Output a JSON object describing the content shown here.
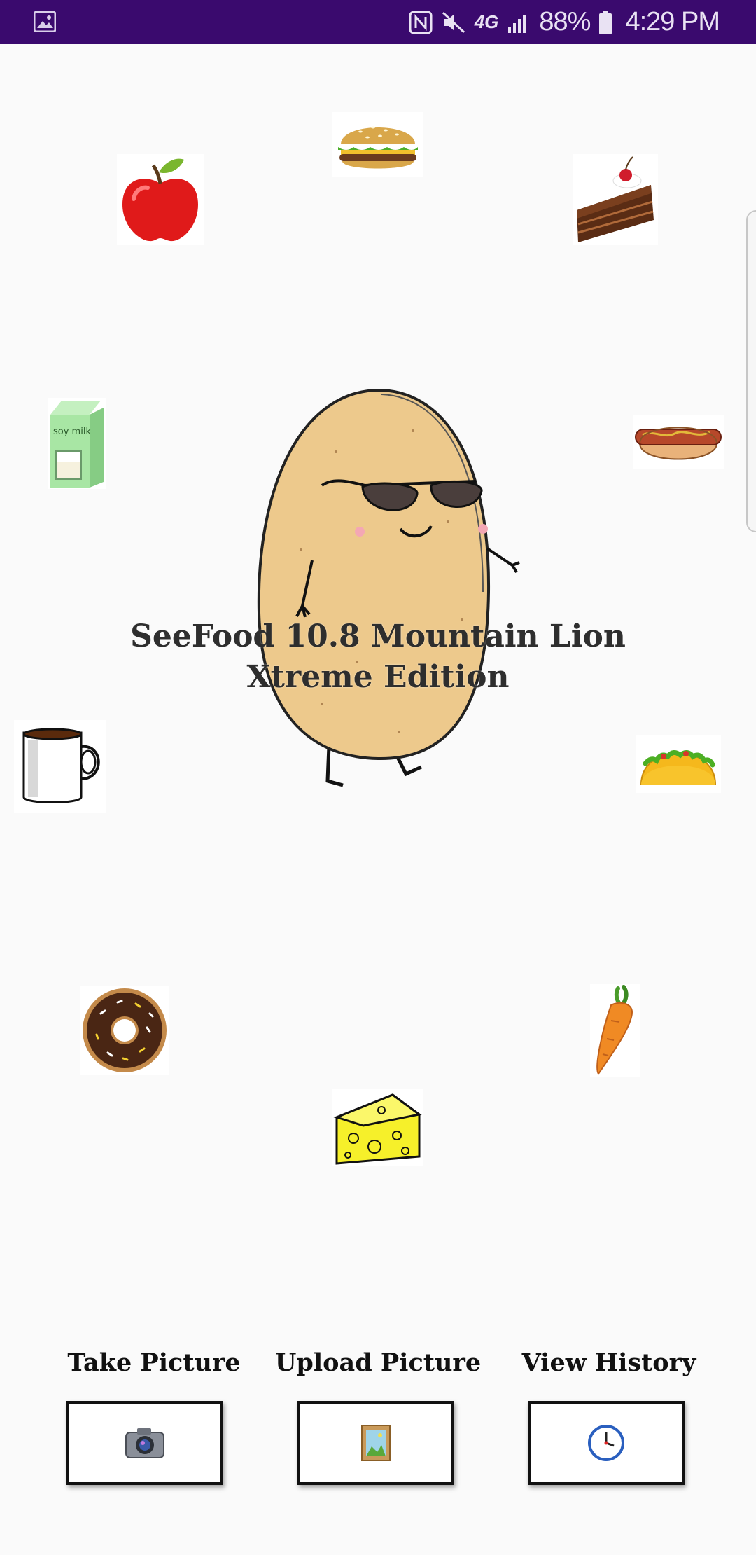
{
  "status_bar": {
    "background": "#3a0a6e",
    "left_icon": "image-notification-icon",
    "icons": [
      "nfc-icon",
      "mute-icon",
      "4g-lte-icon",
      "signal-icon",
      "battery-icon"
    ],
    "network_label": "4G",
    "battery_percent": "88%",
    "time": "4:29 PM"
  },
  "app": {
    "title_line1": "SeeFood 10.8 Mountain Lion",
    "title_line2": "Xtreme Edition",
    "mascot": "potato-with-sunglasses-icon"
  },
  "food_icons": [
    "apple",
    "burger",
    "cake",
    "soy-milk",
    "hot-dog",
    "coffee-mug",
    "taco",
    "donut",
    "carrot",
    "cheese"
  ],
  "soy_milk_label": "soy milk",
  "actions": [
    {
      "label": "Take Picture",
      "icon": "camera-icon"
    },
    {
      "label": "Upload Picture",
      "icon": "picture-frame-icon"
    },
    {
      "label": "View History",
      "icon": "clock-icon"
    }
  ]
}
